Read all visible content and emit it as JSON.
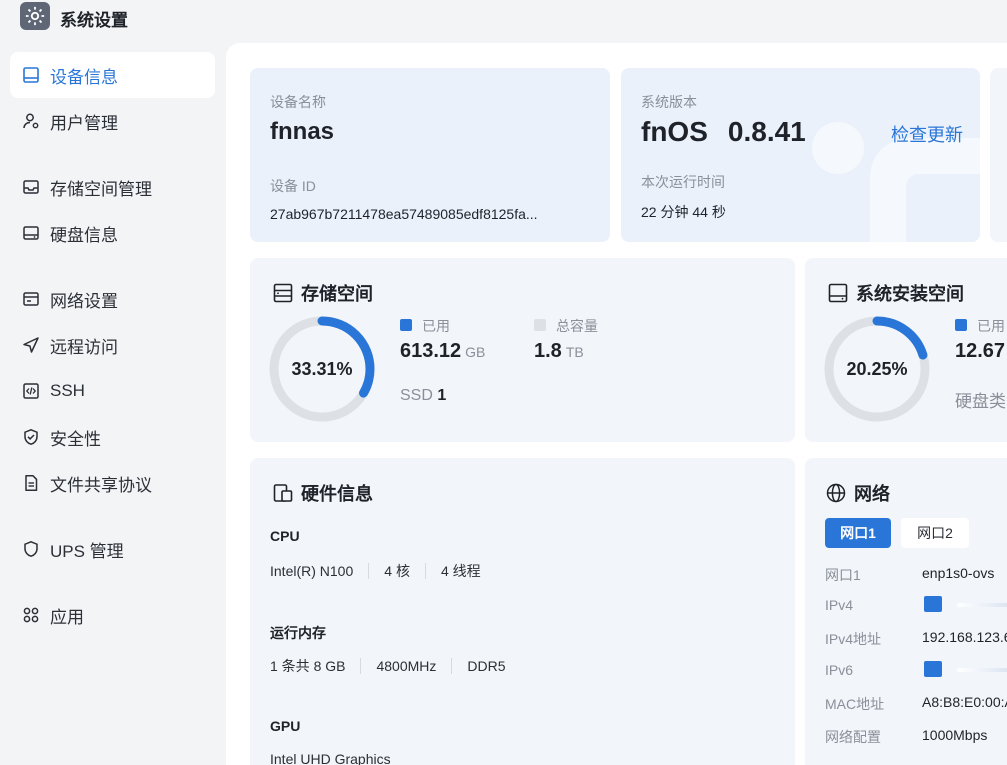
{
  "app": {
    "title": "系统设置",
    "icon": "gear-icon"
  },
  "sidebar": {
    "items": [
      {
        "label": "设备信息",
        "icon": "device-icon",
        "active": true
      },
      {
        "label": "用户管理",
        "icon": "user-gear-icon"
      },
      {
        "label": "存储空间管理",
        "icon": "storage-icon"
      },
      {
        "label": "硬盘信息",
        "icon": "harddisk-icon"
      },
      {
        "label": "网络设置",
        "icon": "network-icon"
      },
      {
        "label": "远程访问",
        "icon": "send-icon"
      },
      {
        "label": "SSH",
        "icon": "code-icon"
      },
      {
        "label": "安全性",
        "icon": "shield-check-icon"
      },
      {
        "label": "文件共享协议",
        "icon": "file-icon"
      },
      {
        "label": "UPS 管理",
        "icon": "shield-icon"
      },
      {
        "label": "应用",
        "icon": "apps-icon"
      }
    ]
  },
  "device": {
    "name_label": "设备名称",
    "name": "fnnas",
    "id_label": "设备 ID",
    "id": "27ab967b7211478ea57489085edf8125fa..."
  },
  "system": {
    "version_label": "系统版本",
    "os": "fnOS",
    "version": "0.8.41",
    "check_update": "检查更新",
    "uptime_label": "本次运行时间",
    "uptime": "22 分钟 44 秒"
  },
  "storage": {
    "title": "存储空间",
    "percent_text": "33.31%",
    "used_fraction": 0.3331,
    "used_label": "已用",
    "used_value": "613.12",
    "used_unit": "GB",
    "total_label": "总容量",
    "total_value": "1.8",
    "total_unit": "TB",
    "ssd_label": "SSD",
    "ssd_count": "1",
    "used_color": "#2a76d8",
    "total_color": "#dde1e6"
  },
  "sys_storage": {
    "title": "系统安装空间",
    "percent_text": "20.25%",
    "used_fraction": 0.2025,
    "used_label": "已用",
    "used_value": "12.67",
    "disk_type_label": "硬盘类"
  },
  "hardware": {
    "title": "硬件信息",
    "cpu_title": "CPU",
    "cpu": [
      "Intel(R) N100",
      "4 核",
      "4 线程"
    ],
    "mem_title": "运行内存",
    "mem": [
      "1 条共 8 GB",
      "4800MHz",
      "DDR5"
    ],
    "gpu_title": "GPU",
    "gpu": "Intel UHD Graphics"
  },
  "network": {
    "title": "网络",
    "tabs": [
      "网口1",
      "网口2"
    ],
    "rows": [
      {
        "key": "网口1",
        "value": "enp1s0-ovs"
      },
      {
        "key": "IPv4",
        "value": ""
      },
      {
        "key": "IPv4地址",
        "value": "192.168.123.6"
      },
      {
        "key": "IPv6",
        "value": ""
      },
      {
        "key": "MAC地址",
        "value": "A8:B8:E0:00:A"
      },
      {
        "key": "网络配置",
        "value": "1000Mbps"
      }
    ]
  }
}
